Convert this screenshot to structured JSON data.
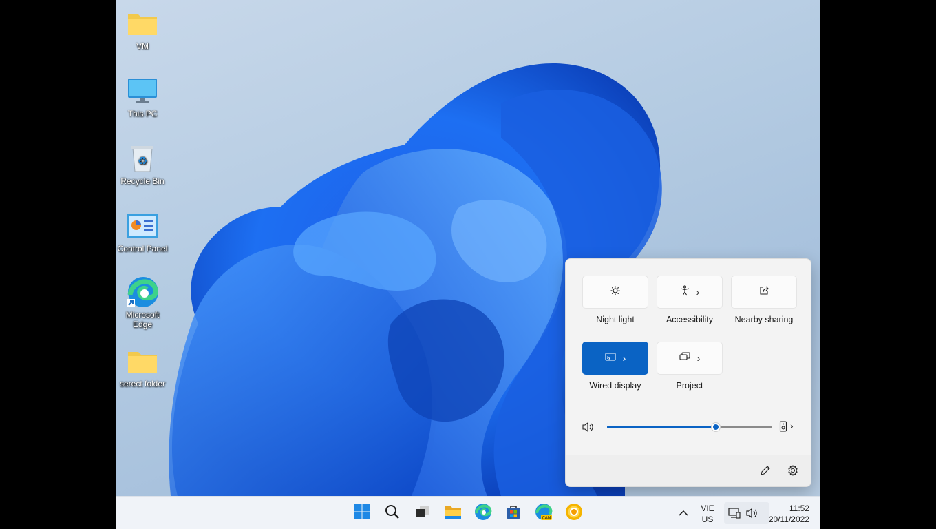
{
  "desktop": {
    "icons": [
      {
        "label": "VM",
        "icon": "folder-icon"
      },
      {
        "label": "This PC",
        "icon": "monitor-icon"
      },
      {
        "label": "Recycle Bin",
        "icon": "recycle-bin-icon"
      },
      {
        "label": "Control Panel",
        "icon": "control-panel-icon"
      },
      {
        "label": "Microsoft Edge",
        "icon": "edge-icon"
      },
      {
        "label": "serect folder",
        "icon": "folder-icon"
      }
    ]
  },
  "quick_settings": {
    "tiles": [
      {
        "label": "Night light",
        "icon": "brightness-icon",
        "active": false,
        "has_chevron": false
      },
      {
        "label": "Accessibility",
        "icon": "accessibility-icon",
        "active": false,
        "has_chevron": true
      },
      {
        "label": "Nearby sharing",
        "icon": "share-icon",
        "active": false,
        "has_chevron": false
      },
      {
        "label": "Wired display",
        "icon": "cast-icon",
        "active": true,
        "has_chevron": true
      },
      {
        "label": "Project",
        "icon": "project-icon",
        "active": false,
        "has_chevron": true
      }
    ],
    "volume": {
      "level_percent": 66,
      "icon": "speaker-icon",
      "output_icon": "audio-output-icon"
    },
    "footer": {
      "edit_icon": "pencil-icon",
      "settings_icon": "gear-icon"
    },
    "accent_color": "#0a63c4"
  },
  "taskbar": {
    "apps": [
      "start-icon",
      "search-icon",
      "task-view-icon",
      "file-explorer-icon",
      "edge-icon",
      "store-icon",
      "edge-canary-icon",
      "chrome-canary-icon"
    ],
    "tray": {
      "language_line1": "VIE",
      "language_line2": "US",
      "time": "11:52",
      "date": "20/11/2022"
    }
  }
}
